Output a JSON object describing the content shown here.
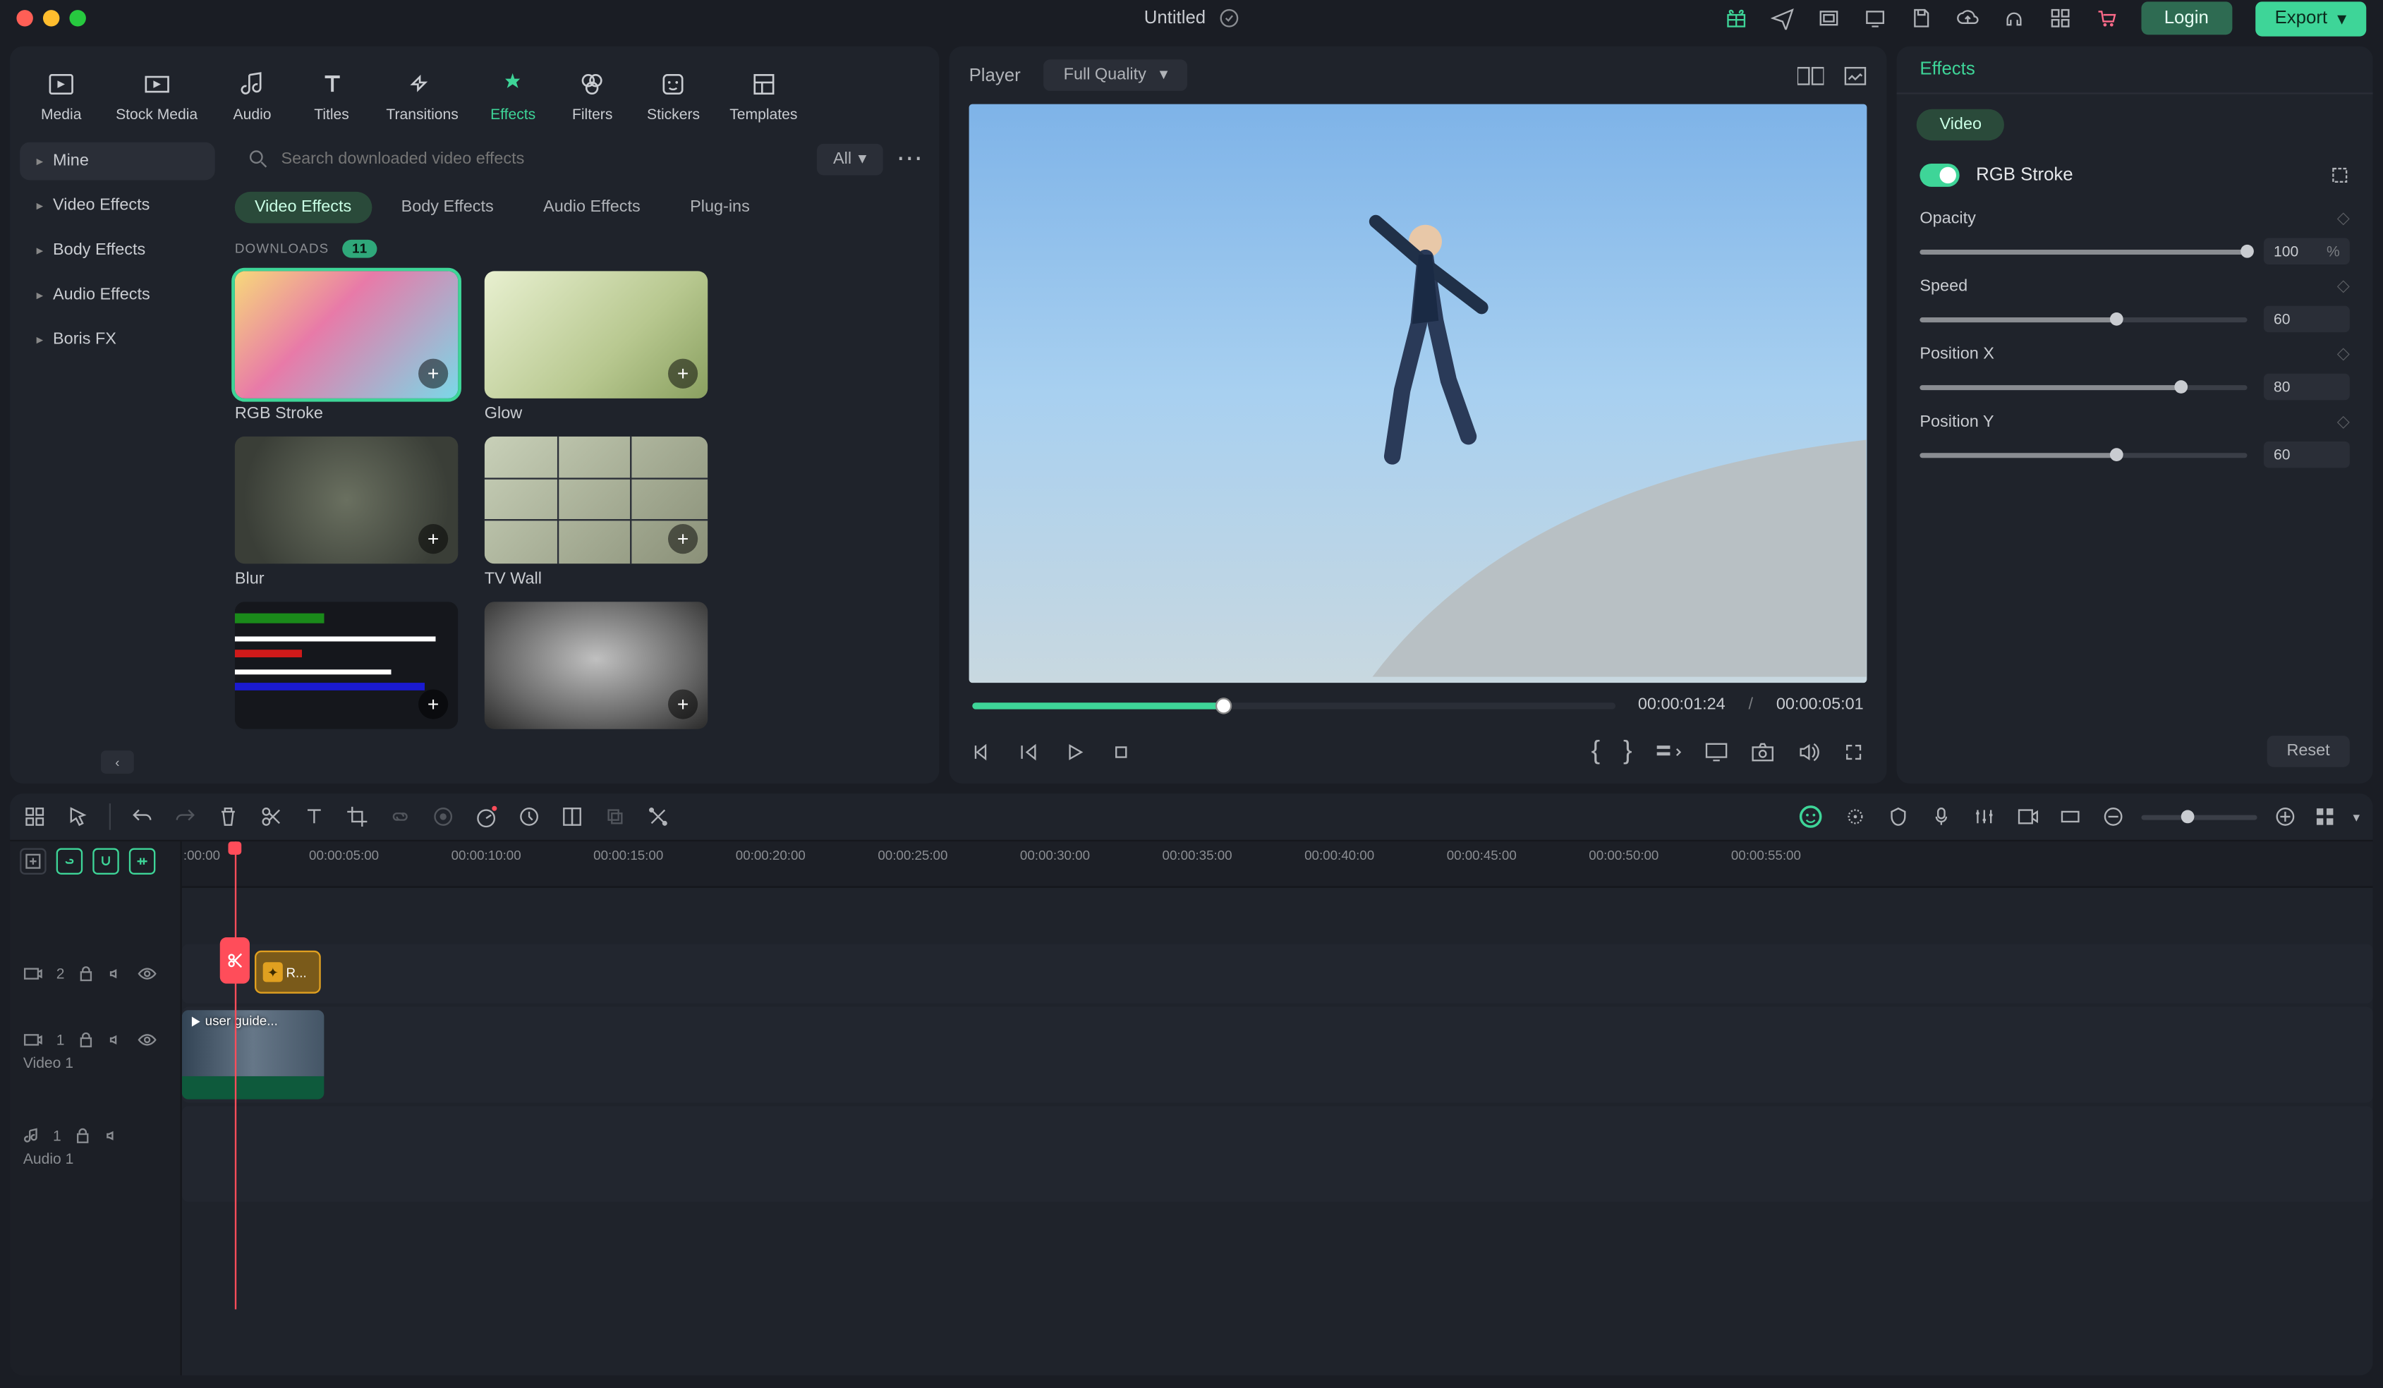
{
  "title": "Untitled",
  "top_icons": [
    "gift",
    "send",
    "screenshot",
    "device",
    "save",
    "cloud",
    "headset",
    "apps",
    "cart"
  ],
  "login_label": "Login",
  "export_label": "Export",
  "tool_tabs": [
    {
      "label": "Media",
      "icon": "media"
    },
    {
      "label": "Stock Media",
      "icon": "stock"
    },
    {
      "label": "Audio",
      "icon": "audio"
    },
    {
      "label": "Titles",
      "icon": "titles"
    },
    {
      "label": "Transitions",
      "icon": "transitions"
    },
    {
      "label": "Effects",
      "icon": "effects",
      "active": true
    },
    {
      "label": "Filters",
      "icon": "filters"
    },
    {
      "label": "Stickers",
      "icon": "stickers"
    },
    {
      "label": "Templates",
      "icon": "templates"
    }
  ],
  "sidebar": [
    {
      "label": "Mine",
      "active": true
    },
    {
      "label": "Video Effects"
    },
    {
      "label": "Body Effects"
    },
    {
      "label": "Audio Effects"
    },
    {
      "label": "Boris FX"
    }
  ],
  "search_placeholder": "Search downloaded video effects",
  "all_label": "All",
  "sub_tabs": [
    "Video Effects",
    "Body Effects",
    "Audio Effects",
    "Plug-ins"
  ],
  "sub_active": 0,
  "downloads_label": "DOWNLOADS",
  "downloads_count": "11",
  "effects_grid": [
    {
      "name": "RGB Stroke",
      "selected": true,
      "thumb": "th-rgb"
    },
    {
      "name": "Glow",
      "thumb": "th-glow"
    },
    {
      "name": "Blur",
      "thumb": "th-blur"
    },
    {
      "name": "TV Wall",
      "thumb": "th-tvwall"
    },
    {
      "name": "",
      "thumb": "th-glitch"
    },
    {
      "name": "",
      "thumb": "th-sketch"
    }
  ],
  "player_label": "Player",
  "quality_label": "Full Quality",
  "time_current": "00:00:01:24",
  "time_total": "00:00:05:01",
  "right_panel": {
    "title": "Effects",
    "tab": "Video",
    "effect_name": "RGB Stroke",
    "params": [
      {
        "label": "Opacity",
        "value": "100",
        "unit": "%",
        "pct": 100
      },
      {
        "label": "Speed",
        "value": "60",
        "unit": "",
        "pct": 60
      },
      {
        "label": "Position X",
        "value": "80",
        "unit": "",
        "pct": 80
      },
      {
        "label": "Position Y",
        "value": "60",
        "unit": "",
        "pct": 60
      }
    ],
    "reset_label": "Reset"
  },
  "ruler": [
    ":00:00",
    "00:00:05:00",
    "00:00:10:00",
    "00:00:15:00",
    "00:00:20:00",
    "00:00:25:00",
    "00:00:30:00",
    "00:00:35:00",
    "00:00:40:00",
    "00:00:45:00",
    "00:00:50:00",
    "00:00:55:00"
  ],
  "tracks": {
    "fx_track_num": "2",
    "vid_track_num": "1",
    "vid_track_label": "Video 1",
    "aud_track_num": "1",
    "aud_track_label": "Audio 1",
    "fx_clip_label": "R...",
    "vid_clip_label": "user guide..."
  }
}
